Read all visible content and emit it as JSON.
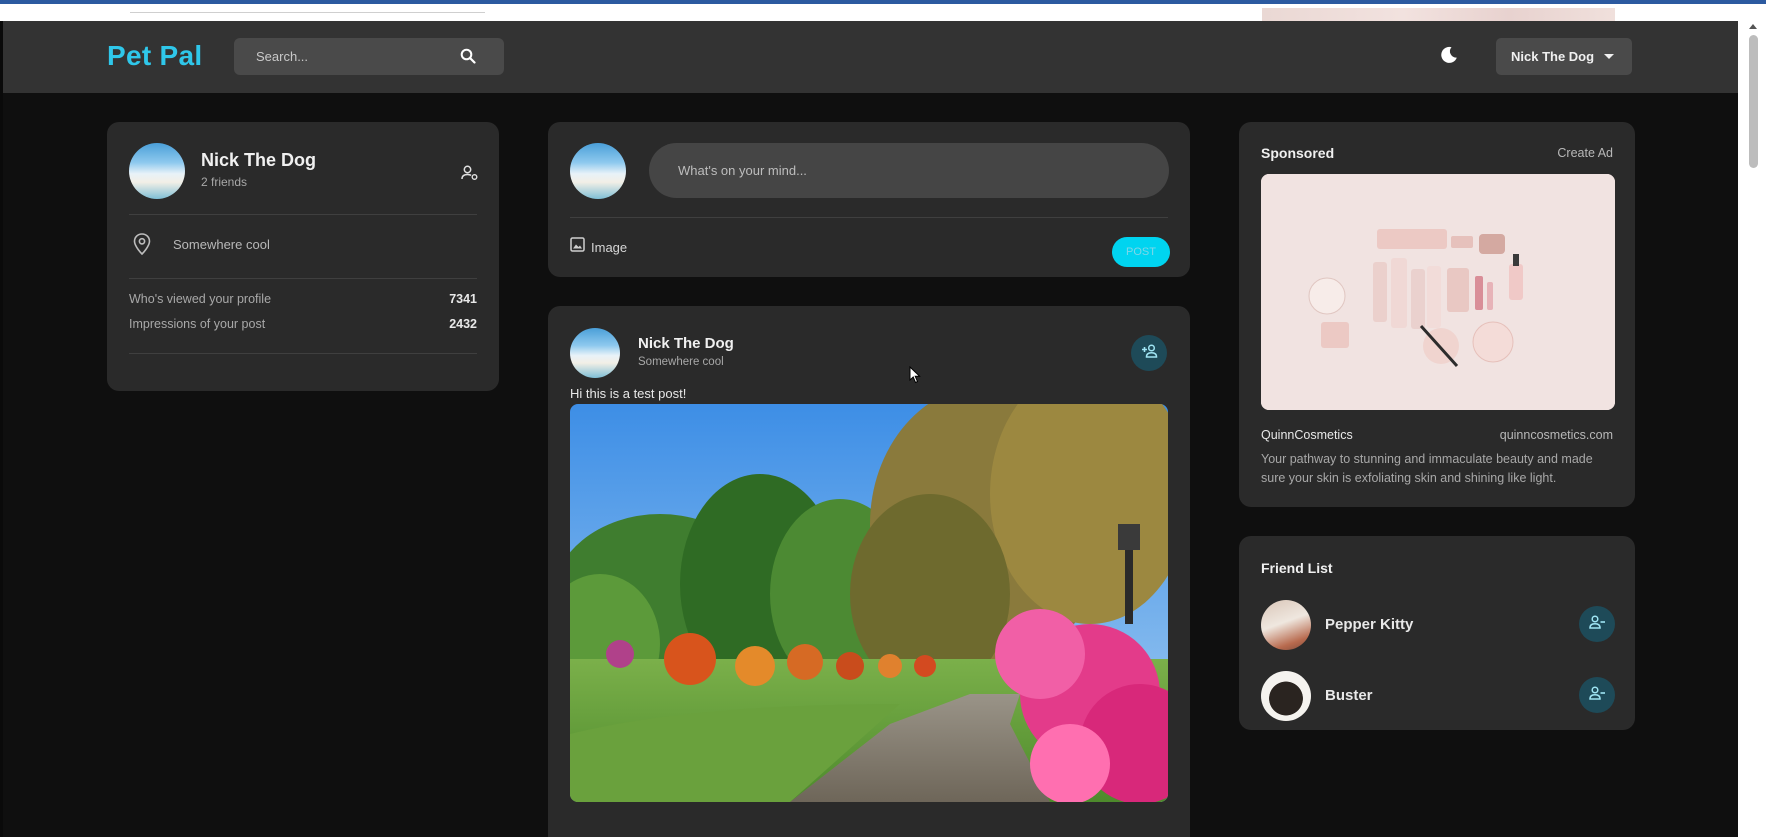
{
  "app": {
    "logo": "Pet Pal"
  },
  "search": {
    "placeholder": "Search..."
  },
  "user_menu": {
    "selected": "Nick The Dog"
  },
  "profile": {
    "name": "Nick The Dog",
    "friends": "2 friends",
    "location": "Somewhere cool",
    "stats": [
      {
        "label": "Who's viewed your profile",
        "value": "7341"
      },
      {
        "label": "Impressions of your post",
        "value": "2432"
      }
    ]
  },
  "composer": {
    "placeholder": "What's on your mind...",
    "image_label": "Image",
    "post_label": "POST"
  },
  "post": {
    "author": "Nick The Dog",
    "location": "Somewhere cool",
    "text": "Hi this is a test post!"
  },
  "sponsored": {
    "title": "Sponsored",
    "create_ad": "Create Ad",
    "brand": "QuinnCosmetics",
    "url": "quinncosmetics.com",
    "description_line1": "Your pathway to stunning and immaculate beauty and made",
    "description_line2": "sure your skin is exfoliating skin and shining like light."
  },
  "friend_list": {
    "title": "Friend List",
    "friends": [
      {
        "name": "Pepper Kitty"
      },
      {
        "name": "Buster"
      }
    ]
  },
  "colors": {
    "accent": "#2fc7ea",
    "nav_bg": "#333333",
    "card_bg": "#2a2a2a",
    "icon_btn_bg": "#1e4a58"
  }
}
